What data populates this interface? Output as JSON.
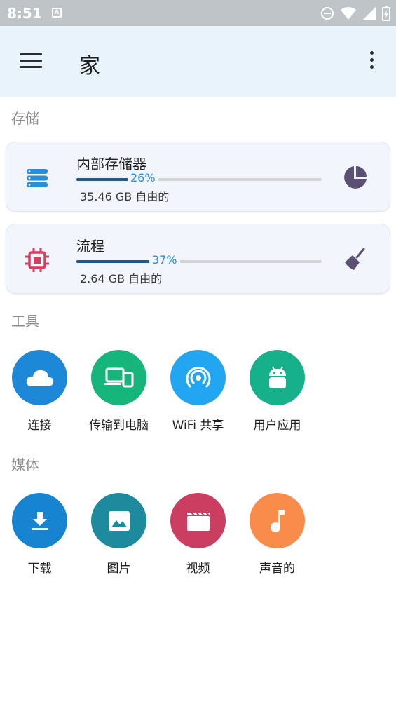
{
  "status_bar": {
    "time": "8:51",
    "a_badge": "A"
  },
  "app_bar": {
    "title": "家",
    "menu_icon": "hamburger-icon",
    "more_icon": "more-vert-icon"
  },
  "sections": {
    "storage": "存储",
    "tools": "工具",
    "media": "媒体"
  },
  "storage_items": [
    {
      "name": "内部存储器",
      "percent_label": "26%",
      "percent": 26,
      "free": "35.46 GB 自由的",
      "icon": "storage-list-icon",
      "action_icon": "pie-chart-icon",
      "icon_color": "#2a8dd8"
    },
    {
      "name": "流程",
      "percent_label": "37%",
      "percent": 37,
      "free": "2.64 GB 自由的",
      "icon": "cpu-chip-icon",
      "action_icon": "broom-icon",
      "icon_color": "#d6405f"
    }
  ],
  "tools": [
    {
      "label": "连接",
      "icon": "cloud-icon",
      "color": "#1e88d8"
    },
    {
      "label": "传输到电脑",
      "icon": "devices-icon",
      "color": "#16b57c"
    },
    {
      "label": "WiFi 共享",
      "icon": "wifi-hotspot-icon",
      "color": "#22a6f2"
    },
    {
      "label": "用户应用",
      "icon": "android-icon",
      "color": "#16b08a"
    }
  ],
  "media": [
    {
      "label": "下载",
      "icon": "download-icon",
      "color": "#1684d0"
    },
    {
      "label": "图片",
      "icon": "image-icon",
      "color": "#1e8a9e"
    },
    {
      "label": "视频",
      "icon": "video-clapper-icon",
      "color": "#cc3d62"
    },
    {
      "label": "声音的",
      "icon": "music-note-icon",
      "color": "#f98c4a"
    }
  ]
}
